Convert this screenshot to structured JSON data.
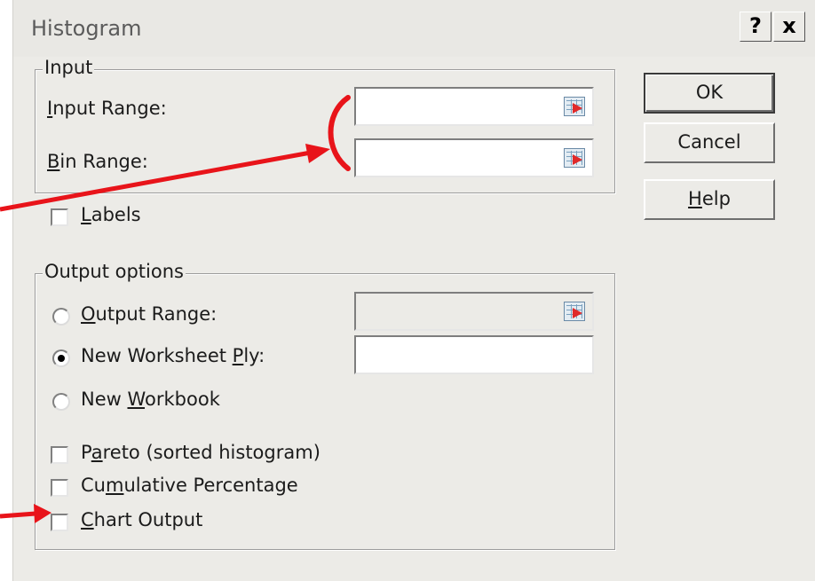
{
  "window": {
    "title": "Histogram",
    "help_glyph": "?",
    "close_glyph": "x"
  },
  "input_group": {
    "legend": "Input",
    "input_range": {
      "label": "Input Range:",
      "accel": "I",
      "rest": "nput Range:",
      "value": ""
    },
    "bin_range": {
      "label": "Bin Range:",
      "accel": "B",
      "rest": "in Range:",
      "value": ""
    },
    "labels_check": {
      "label": "Labels",
      "accel": "L",
      "rest": "abels",
      "checked": false
    }
  },
  "buttons": {
    "ok": "OK",
    "cancel": "Cancel",
    "help": "Help",
    "help_accel": "H",
    "help_rest": "elp"
  },
  "output_group": {
    "legend": "Output options",
    "output_range": {
      "label": "Output Range:",
      "accel": "O",
      "rest": "utput Range:",
      "selected": false,
      "value": ""
    },
    "new_worksheet": {
      "label": "New Worksheet Ply:",
      "pre": "New Worksheet ",
      "accel": "P",
      "rest": "ly:",
      "selected": true,
      "value": ""
    },
    "new_workbook": {
      "label": "New Workbook",
      "pre": "New ",
      "accel": "W",
      "rest": "orkbook",
      "selected": false
    },
    "pareto": {
      "label": "Pareto (sorted histogram)",
      "accel": "a",
      "pre": "P",
      "rest": "reto (sorted histogram)",
      "checked": false
    },
    "cumulative": {
      "label": "Cumulative Percentage",
      "pre": "Cu",
      "accel": "m",
      "rest": "ulative Percentage",
      "checked": false
    },
    "chart_output": {
      "label": "Chart Output",
      "accel": "C",
      "rest": "hart Output",
      "checked": false
    }
  },
  "colors": {
    "annotation": "#e8141a",
    "dialog_bg": "#ecebe7"
  }
}
